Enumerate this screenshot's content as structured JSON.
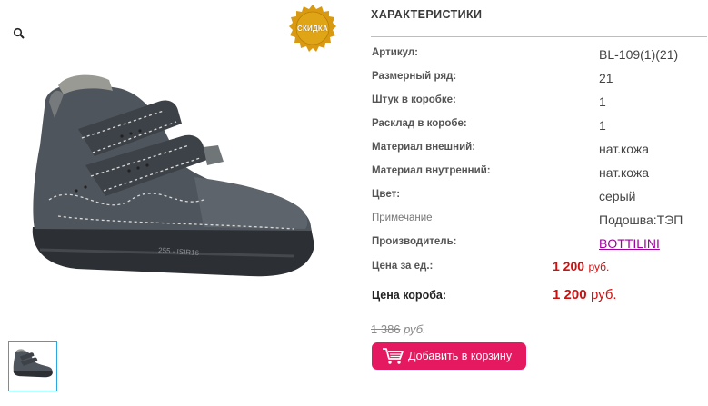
{
  "gallery": {
    "zoom_icon": "magnifier-icon",
    "badge_text": "СКИДКА"
  },
  "characteristics": {
    "title": "ХАРАКТЕРИСТИКИ",
    "rows": [
      {
        "label": "Артикул:",
        "value": "BL-109(1)(21)"
      },
      {
        "label": "Размерный ряд:",
        "value": "21"
      },
      {
        "label": "Штук в коробке:",
        "value": "1"
      },
      {
        "label": "Расклад в коробе:",
        "value": "1"
      },
      {
        "label": "Материал внешний:",
        "value": "нат.кожа"
      },
      {
        "label": "Материал внутренний:",
        "value": "нат.кожа"
      },
      {
        "label": "Цвет:",
        "value": "серый"
      },
      {
        "label": "Примечание",
        "value": "Подошва:ТЭП"
      },
      {
        "label": "Производитель:",
        "value": "BOTTILINI"
      }
    ]
  },
  "pricing": {
    "unit_label": "Цена за ед.:",
    "unit_price": "1 200",
    "unit_currency": "руб.",
    "box_label": "Цена короба:",
    "box_price": "1 200",
    "box_currency": "руб.",
    "old_price": "1 386",
    "old_currency": "руб."
  },
  "cart_button": {
    "label": "Добавить в корзину",
    "icon": "shopping-cart-icon"
  },
  "colors": {
    "accent": "#e5195f",
    "price": "#cc1111",
    "link": "#a000a0",
    "thumb_border": "#2aa7e0",
    "badge": "#d99a12"
  }
}
